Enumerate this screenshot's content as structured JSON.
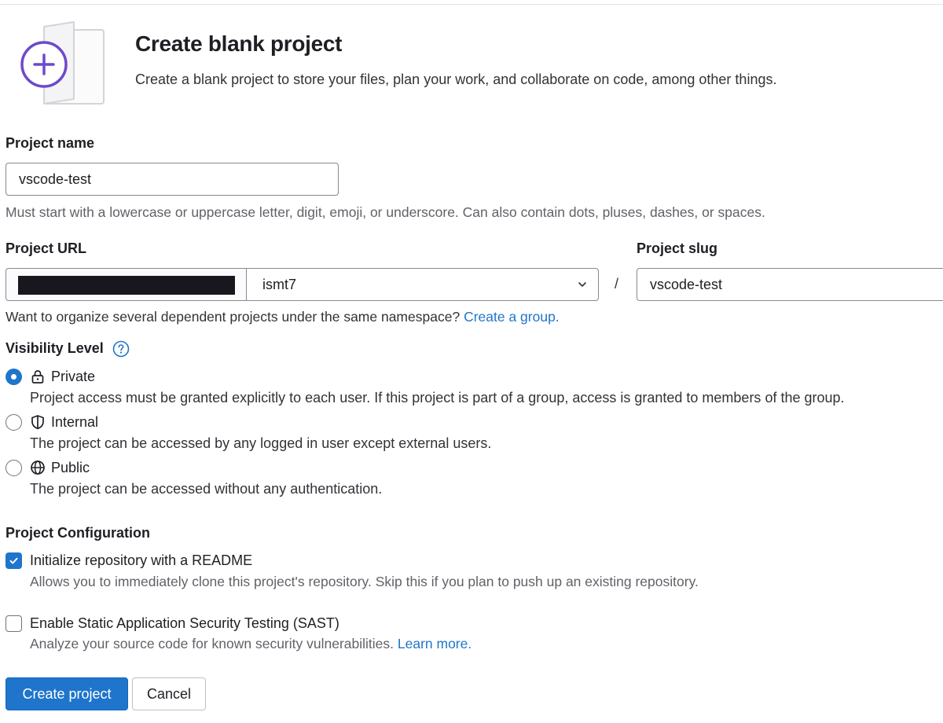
{
  "header": {
    "title": "Create blank project",
    "description": "Create a blank project to store your files, plan your work, and collaborate on code, among other things.",
    "illustration_icon": "plus-icon",
    "accent": "#6e49cb"
  },
  "project_name": {
    "label": "Project name",
    "value": "vscode-test",
    "help": "Must start with a lowercase or uppercase letter, digit, emoji, or underscore. Can also contain dots, pluses, dashes, or spaces."
  },
  "project_url": {
    "label": "Project URL",
    "namespace": "ismt7",
    "separator": "/"
  },
  "project_slug": {
    "label": "Project slug",
    "value": "vscode-test"
  },
  "group_hint": {
    "text": "Want to organize several dependent projects under the same namespace?",
    "link": "Create a group."
  },
  "visibility": {
    "label": "Visibility Level",
    "help_icon": "question-circle-icon",
    "options": [
      {
        "title": "Private",
        "icon": "lock-icon",
        "checked": true,
        "description": "Project access must be granted explicitly to each user. If this project is part of a group, access is granted to members of the group."
      },
      {
        "title": "Internal",
        "icon": "shield-icon",
        "checked": false,
        "description": "The project can be accessed by any logged in user except external users."
      },
      {
        "title": "Public",
        "icon": "globe-icon",
        "checked": false,
        "description": "The project can be accessed without any authentication."
      }
    ]
  },
  "configuration": {
    "label": "Project Configuration",
    "readme": {
      "title": "Initialize repository with a README",
      "checked": true,
      "description": "Allows you to immediately clone this project's repository. Skip this if you plan to push up an existing repository."
    },
    "sast": {
      "title": "Enable Static Application Security Testing (SAST)",
      "checked": false,
      "description": "Analyze your source code for known security vulnerabilities.",
      "link": "Learn more."
    }
  },
  "actions": {
    "create": "Create project",
    "cancel": "Cancel"
  },
  "colors": {
    "primary": "#1f75cb",
    "link": "#1f75cb",
    "text": "#1f1e24",
    "muted": "#626168"
  }
}
